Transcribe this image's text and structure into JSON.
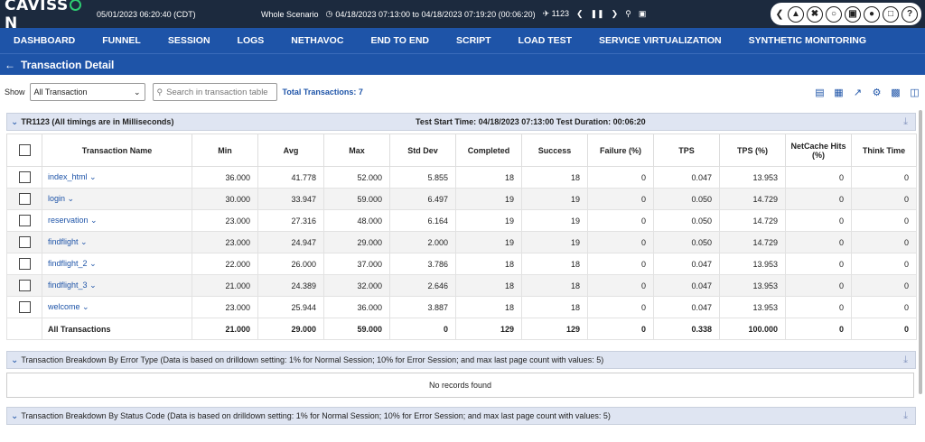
{
  "topbar": {
    "logo_prefix": "CAVISS",
    "logo_suffix": "N",
    "date": "05/01/2023 06:20:40 (CDT)",
    "scenario": "Whole Scenario",
    "time_range": "04/18/2023 07:13:00 to 04/18/2023 07:19:20 (00:06:20)",
    "test_run": "1123"
  },
  "nav": {
    "items": [
      "DASHBOARD",
      "FUNNEL",
      "SESSION",
      "LOGS",
      "NETHAVOC",
      "END TO END",
      "SCRIPT",
      "LOAD TEST",
      "SERVICE VIRTUALIZATION",
      "SYNTHETIC MONITORING"
    ]
  },
  "subbar": {
    "title": "Transaction Detail"
  },
  "toolbar": {
    "show_label": "Show",
    "select_value": "All Transaction",
    "search_placeholder": "Search in transaction table",
    "total": "Total Transactions: 7"
  },
  "section1": {
    "title": "TR1123 (All timings are in Milliseconds)",
    "info": "Test Start Time: 04/18/2023 07:13:00 Test Duration: 00:06:20"
  },
  "table": {
    "headers": [
      "Transaction Name",
      "Min",
      "Avg",
      "Max",
      "Std Dev",
      "Completed",
      "Success",
      "Failure (%)",
      "TPS",
      "TPS (%)",
      "NetCache Hits (%)",
      "Think Time"
    ],
    "rows": [
      {
        "name": "index_html",
        "min": "36.000",
        "avg": "41.778",
        "max": "52.000",
        "std": "5.855",
        "completed": "18",
        "success": "18",
        "failure": "0",
        "tps": "0.047",
        "tps_pct": "13.953",
        "netcache": "0",
        "think": "0"
      },
      {
        "name": "login",
        "min": "30.000",
        "avg": "33.947",
        "max": "59.000",
        "std": "6.497",
        "completed": "19",
        "success": "19",
        "failure": "0",
        "tps": "0.050",
        "tps_pct": "14.729",
        "netcache": "0",
        "think": "0"
      },
      {
        "name": "reservation",
        "min": "23.000",
        "avg": "27.316",
        "max": "48.000",
        "std": "6.164",
        "completed": "19",
        "success": "19",
        "failure": "0",
        "tps": "0.050",
        "tps_pct": "14.729",
        "netcache": "0",
        "think": "0"
      },
      {
        "name": "findflight",
        "min": "23.000",
        "avg": "24.947",
        "max": "29.000",
        "std": "2.000",
        "completed": "19",
        "success": "19",
        "failure": "0",
        "tps": "0.050",
        "tps_pct": "14.729",
        "netcache": "0",
        "think": "0"
      },
      {
        "name": "findflight_2",
        "min": "22.000",
        "avg": "26.000",
        "max": "37.000",
        "std": "3.786",
        "completed": "18",
        "success": "18",
        "failure": "0",
        "tps": "0.047",
        "tps_pct": "13.953",
        "netcache": "0",
        "think": "0"
      },
      {
        "name": "findflight_3",
        "min": "21.000",
        "avg": "24.389",
        "max": "32.000",
        "std": "2.646",
        "completed": "18",
        "success": "18",
        "failure": "0",
        "tps": "0.047",
        "tps_pct": "13.953",
        "netcache": "0",
        "think": "0"
      },
      {
        "name": "welcome",
        "min": "23.000",
        "avg": "25.944",
        "max": "36.000",
        "std": "3.887",
        "completed": "18",
        "success": "18",
        "failure": "0",
        "tps": "0.047",
        "tps_pct": "13.953",
        "netcache": "0",
        "think": "0"
      }
    ],
    "total": {
      "name": "All Transactions",
      "min": "21.000",
      "avg": "29.000",
      "max": "59.000",
      "std": "0",
      "completed": "129",
      "success": "129",
      "failure": "0",
      "tps": "0.338",
      "tps_pct": "100.000",
      "netcache": "0",
      "think": "0"
    }
  },
  "section2": {
    "title": "Transaction Breakdown By Error Type (Data is based on drilldown setting: 1% for Normal Session; 10% for Error Session; and max last page count with values: 5)",
    "empty": "No records found"
  },
  "section3": {
    "title": "Transaction Breakdown By Status Code (Data is based on drilldown setting: 1% for Normal Session; 10% for Error Session; and max last page count with values: 5)"
  }
}
